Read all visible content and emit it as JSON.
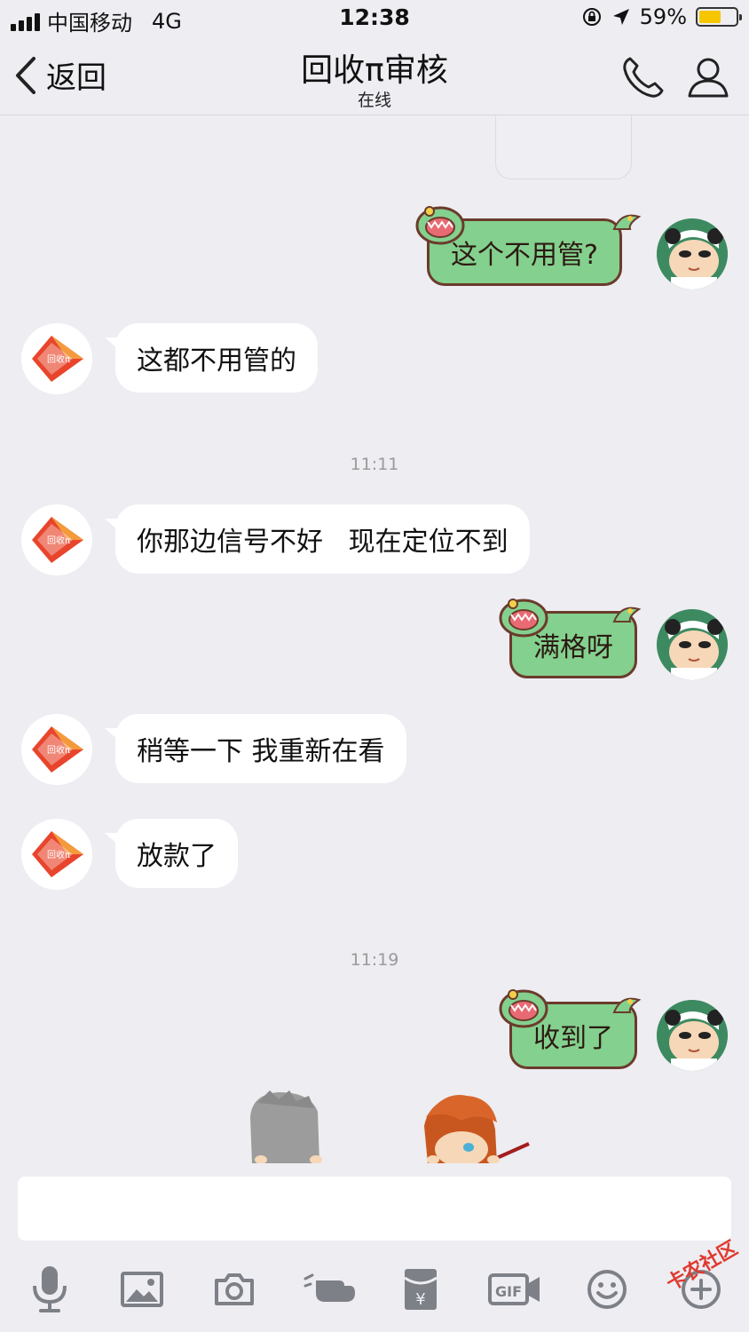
{
  "status_bar": {
    "carrier": "中国移动",
    "network": "4G",
    "time": "12:38",
    "battery": "59%",
    "battery_level": 0.59,
    "icons": [
      "signal-icon",
      "rotation-lock-icon",
      "location-arrow-icon",
      "battery-icon"
    ]
  },
  "nav": {
    "back_label": "返回",
    "title": "回收π审核",
    "subtitle": "在线",
    "icons": [
      "back-chevron-icon",
      "phone-icon",
      "profile-icon"
    ]
  },
  "messages": [
    {
      "side": "right",
      "text": "这个不用管?"
    },
    {
      "side": "left",
      "text": "这都不用管的"
    },
    {
      "type": "time",
      "text": "11:11"
    },
    {
      "side": "left",
      "text": "你那边信号不好   现在定位不到"
    },
    {
      "side": "right",
      "text": "满格呀"
    },
    {
      "side": "left",
      "text": "稍等一下 我重新在看"
    },
    {
      "side": "left",
      "text": "放款了"
    },
    {
      "type": "time",
      "text": "11:19"
    },
    {
      "side": "right",
      "text": "收到了"
    }
  ],
  "bot_avatar_text": "回收π",
  "input": {
    "value": "",
    "placeholder": ""
  },
  "toolbar": [
    "microphone-icon",
    "image-icon",
    "camera-icon",
    "poke-hand-icon",
    "red-packet-icon",
    "gif-icon",
    "emoji-icon",
    "plus-icon"
  ],
  "watermark": "卡农社区",
  "colors": {
    "background": "#ededf2",
    "outgoing_bubble": "#84d08e",
    "outgoing_border": "#6b3b2c",
    "accent_bot": "#e8452c"
  }
}
